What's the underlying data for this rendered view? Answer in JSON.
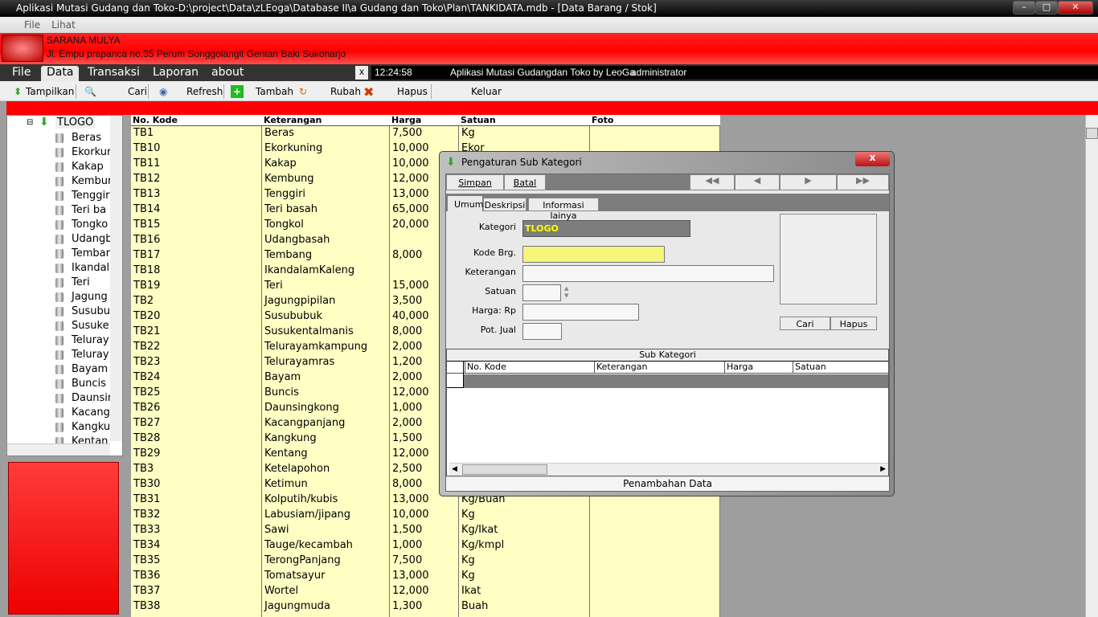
{
  "window": {
    "title": "Aplikasi Mutasi Gudang dan Toko-D:\\project\\Data\\zLEoga\\Database II\\a Gudang dan Toko\\Plan\\TANKIDATA.mdb - [Data Barang / Stok]"
  },
  "menu1": [
    "File",
    "Lihat"
  ],
  "banner": {
    "company": "SARANA MULYA",
    "address": "Jl. Empu prapanca no.35 Perum Songgolangit Gentan Baki Sukoharjo"
  },
  "menu2": {
    "items": [
      "File",
      "Data",
      "Transaksi",
      "Laporan",
      "about"
    ],
    "active": "Data",
    "close": "x",
    "time": "12:24:58",
    "app": "Aplikasi Mutasi Gudangdan Toko by LeoGa",
    "user": "administrator"
  },
  "toolbar": {
    "tampilkan": "Tampilkan",
    "cari": "Cari",
    "refresh": "Refresh",
    "tambah": "Tambah",
    "rubah": "Rubah",
    "hapus": "Hapus",
    "keluar": "Keluar"
  },
  "tree": {
    "root": "TLOGO",
    "items": [
      "Beras",
      "Ekorkur",
      "Kakap",
      "Kembur",
      "Tenggir",
      "Teri ba",
      "Tongko",
      "Udangb",
      "Tembar",
      "Ikandal",
      "Teri",
      "Jagung",
      "Susubu",
      "Susuke",
      "Teluray",
      "Teluray",
      "Bayam",
      "Buncis",
      "Daunsir",
      "Kacang",
      "Kangku",
      "Kentan"
    ]
  },
  "grid": {
    "headers": [
      "No. Kode",
      "Keterangan",
      "Harga",
      "Satuan",
      "Foto"
    ],
    "rows": [
      [
        "TB1",
        "Beras",
        "7,500",
        "Kg"
      ],
      [
        "TB10",
        "Ekorkuning",
        "10,000",
        "Ekor"
      ],
      [
        "TB11",
        "Kakap",
        "10,000",
        ""
      ],
      [
        "TB12",
        "Kembung",
        "12,000",
        ""
      ],
      [
        "TB13",
        "Tenggiri",
        "13,000",
        ""
      ],
      [
        "TB14",
        "Teri basah",
        "65,000",
        ""
      ],
      [
        "TB15",
        "Tongkol",
        "20,000",
        ""
      ],
      [
        "TB16",
        "Udangbasah",
        "",
        ""
      ],
      [
        "TB17",
        "Tembang",
        "8,000",
        ""
      ],
      [
        "TB18",
        "IkandalamKaleng",
        "",
        ""
      ],
      [
        "TB19",
        "Teri",
        "15,000",
        ""
      ],
      [
        "TB2",
        "Jagungpipilan",
        "3,500",
        ""
      ],
      [
        "TB20",
        "Susububuk",
        "40,000",
        ""
      ],
      [
        "TB21",
        "Susukentalmanis",
        "8,000",
        ""
      ],
      [
        "TB22",
        "Telurayamkampung",
        "2,000",
        ""
      ],
      [
        "TB23",
        "Telurayamras",
        "1,200",
        ""
      ],
      [
        "TB24",
        "Bayam",
        "2,000",
        ""
      ],
      [
        "TB25",
        "Buncis",
        "12,000",
        ""
      ],
      [
        "TB26",
        "Daunsingkong",
        "1,000",
        ""
      ],
      [
        "TB27",
        "Kacangpanjang",
        "2,000",
        ""
      ],
      [
        "TB28",
        "Kangkung",
        "1,500",
        ""
      ],
      [
        "TB29",
        "Kentang",
        "12,000",
        ""
      ],
      [
        "TB3",
        "Ketelapohon",
        "2,500",
        ""
      ],
      [
        "TB30",
        "Ketimun",
        "8,000",
        ""
      ],
      [
        "TB31",
        "Kolputih/kubis",
        "13,000",
        "Kg/Buah"
      ],
      [
        "TB32",
        "Labusiam/jipang",
        "10,000",
        "Kg"
      ],
      [
        "TB33",
        " Sawi",
        "1,500",
        "Kg/Ikat"
      ],
      [
        "TB34",
        " Tauge/kecambah",
        "1,000",
        "Kg/kmpl"
      ],
      [
        "TB35",
        " TerongPanjang",
        "7,500",
        "Kg"
      ],
      [
        "TB36",
        " Tomatsayur",
        "13,000",
        "Kg"
      ],
      [
        "TB37",
        " Wortel",
        "12,000",
        "Ikat"
      ],
      [
        "TB38",
        " Jagungmuda",
        "1,300",
        "Buah"
      ]
    ]
  },
  "dialog": {
    "title": "Pengaturan Sub Kategori",
    "simpan": "Simpan",
    "batal": "Batal",
    "tabs": [
      "Umum",
      "Deskripsi",
      "Informasi lainya"
    ],
    "labels": {
      "kategori": "Kategori",
      "kode": "Kode Brg.",
      "keterangan": "Keterangan",
      "satuan": "Satuan",
      "harga": "Harga: Rp",
      "pot": "Pot. Jual"
    },
    "kategori_value": "TLOGO",
    "cari": "Cari",
    "hapus": "Hapus",
    "sub_title": "Sub Kategori",
    "sub_headers": [
      "No. Kode",
      "Keterangan",
      "Harga",
      "Satuan"
    ],
    "status": "Penambahan Data"
  }
}
